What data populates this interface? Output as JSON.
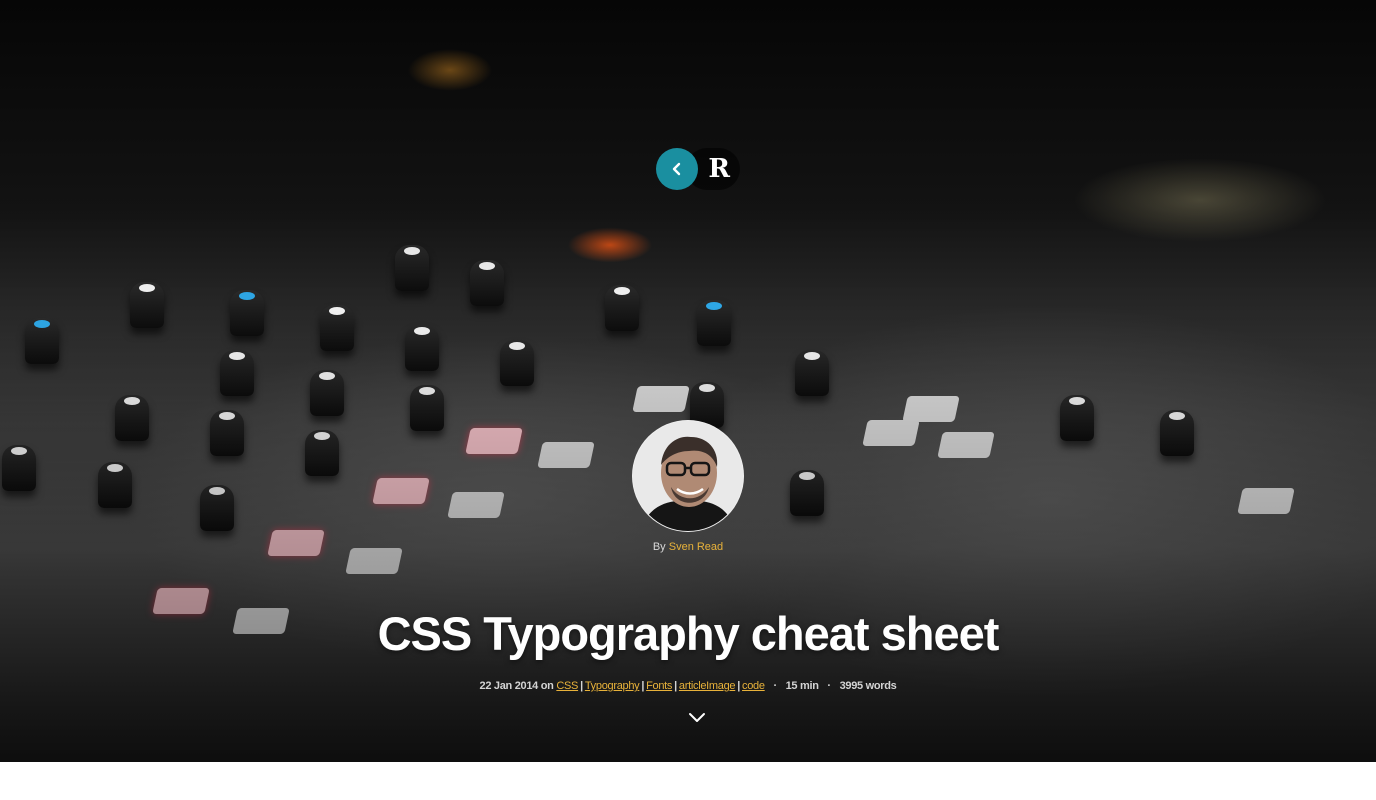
{
  "header": {
    "back_icon": "chevron-left-icon",
    "logo_text": "R",
    "accent_color": "#1a8fa0"
  },
  "author": {
    "by_label": "By",
    "name": "Sven Read",
    "link_color": "#e8b23a"
  },
  "article": {
    "title": "CSS Typography cheat sheet",
    "date": "22 Jan 2014",
    "on_label": "on",
    "tags": [
      "CSS",
      "Typography",
      "Fonts",
      "articleImage",
      "code"
    ],
    "read_time": "15 min",
    "word_count": "3995 words"
  },
  "scroll": {
    "icon": "chevron-down-icon"
  }
}
